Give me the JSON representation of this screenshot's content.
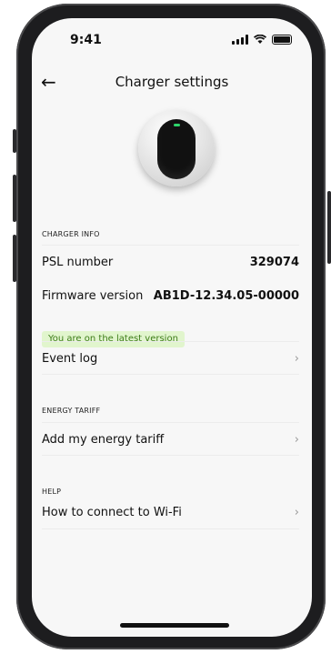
{
  "status_bar": {
    "time": "9:41"
  },
  "nav": {
    "back_icon": "←",
    "title": "Charger settings"
  },
  "sections": {
    "charger_info": {
      "header": "CHARGER INFO",
      "psl_label": "PSL number",
      "psl_value": "329074",
      "firmware_label": "Firmware version",
      "firmware_value": "AB1D-12.34.05-00000",
      "firmware_badge": "You are on the latest version",
      "event_log_label": "Event log"
    },
    "energy_tariff": {
      "header": "ENERGY TARIFF",
      "add_tariff_label": "Add my energy tariff"
    },
    "help": {
      "header": "HELP",
      "wifi_label": "How to connect to Wi-Fi"
    }
  },
  "chevron": "›",
  "colors": {
    "badge_bg": "#e1f5cd",
    "badge_text": "#3d7d18",
    "led": "#2ed66b"
  }
}
